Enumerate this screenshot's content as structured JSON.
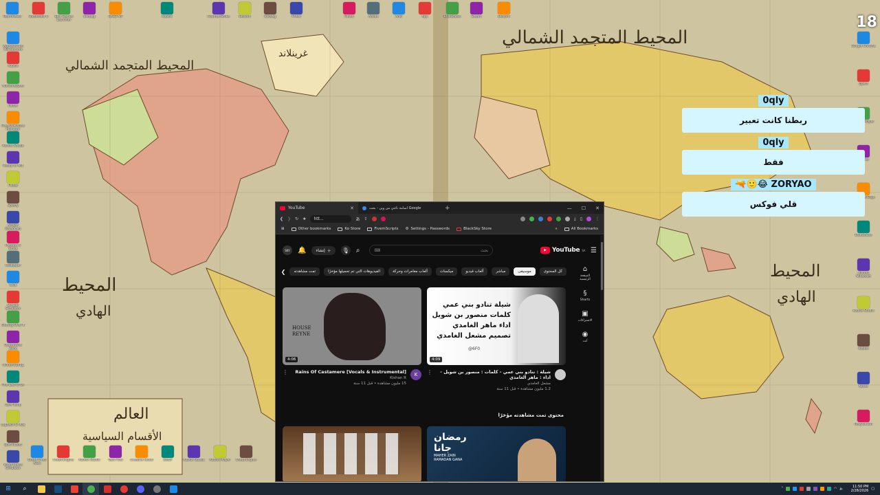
{
  "desktop": {
    "map_labels": {
      "north_pacific_left": "المحيط المتجمد الشمالي",
      "greenland": "غرينلاند",
      "north_pacific_right": "المحيط المتجمد الشمالي",
      "pacific_left": "المحيط",
      "pacific_left2": "الهادي",
      "pacific_right": "المحيط",
      "pacific_right2": "الهادي",
      "legend_title": "العالم",
      "legend_sub": "الأقسام السياسية"
    },
    "icons_top": [
      "TeamViewer",
      "Battlefield 4",
      "Epic Games Launcher",
      "ExitLag",
      "RAGE MP",
      "Roblox",
      "Counter-Strike",
      "Discord",
      "ExitLag",
      "FiveM",
      "Folder",
      "Adobe",
      "Anki",
      "App",
      "BlueStacks",
      "Steam",
      "Discord"
    ],
    "icons_left": [
      "Wondershare PDFelement",
      "Roblox",
      "Malwarebytes",
      "Folder",
      "Free Download Manager",
      "Roblox Studio",
      "Ready or Not",
      "Folder",
      "Spotify",
      "NVIDIA Broadcast",
      "Persona 5 Strike",
      "Wallpaper",
      "Wick",
      "Burglar Simulator",
      "Getting Over It",
      "Quarantine Zone",
      "HiddenConfig",
      "The Last of Us",
      "Core Temp",
      "Logitech G HUB",
      "Split Fiction",
      "Wrap House Simulator"
    ],
    "icons_right": [
      "Google Chrome",
      "Opera",
      "Roblox Player",
      "Games",
      "Microsoft Edge",
      "BlueStacks",
      "Hidden Minecraft",
      "Roblox Studio",
      "Roblox",
      "Notes",
      "Recycle Bin"
    ],
    "icons_bottom": [
      "Grand Theft Auto",
      "Cheat Engine",
      "Roblox Studio",
      "Task Flow",
      "Creative Cloud",
      "Zettlr",
      "Roblox Studio",
      "Roblox Player",
      "Cheat Engine"
    ],
    "corner_badge": "18"
  },
  "chat": [
    {
      "name": "0qly",
      "text": "ربطنا كانت تعبير"
    },
    {
      "name": "0qly",
      "text": "فقط"
    },
    {
      "name": "ZORYAO",
      "prefix": "🔫🙂😂",
      "text": "قلي فوكس"
    }
  ],
  "browser": {
    "tabs": [
      {
        "label": "YouTube",
        "active": true
      },
      {
        "label": "اسامة تاجي من وين - بحث Google",
        "active": false
      }
    ],
    "new_tab": "+",
    "window_controls": {
      "minimize": "—",
      "maximize": "☐",
      "close": "✕"
    },
    "url": "htt...",
    "bookmarks": [
      "Other bookmarks",
      "Ko Store",
      "FivemScripts",
      "Settings - Passwords",
      "BlackSky Store"
    ],
    "all_bookmarks": "All Bookmarks"
  },
  "youtube": {
    "logo": "YouTube",
    "logo_region": "SA",
    "search_placeholder": "بحث",
    "create_label": "إنشاء",
    "avatar_initials": "SKY",
    "chips": [
      "كل المحتوى",
      "موسيقى",
      "مباشر",
      "ألعاب فيديو",
      "ميكسات",
      "ألعاب مغامرات وحركة",
      "الفيديوهات التي تم تحميلها مؤخرًا",
      "تمت مشاهدته"
    ],
    "selected_chip": "موسيقى",
    "sidebar": [
      {
        "icon": "home-icon",
        "label": "الصفحة الرئيسية"
      },
      {
        "icon": "shorts-icon",
        "label": "Shorts"
      },
      {
        "icon": "subscriptions-icon",
        "label": "الاشتراكات"
      },
      {
        "icon": "you-icon",
        "label": "أنت"
      }
    ],
    "videos": [
      {
        "duration": "4:09",
        "thumb_lines": [
          "شيلة تنادو بني عمي",
          "كلمات منصور بن شويل",
          "اداء ماهر الغامدي",
          "تصميم مشعل الغامدي"
        ],
        "thumb_tag": "@6F0",
        "title": "شيلة : تنادو بني عمي - كلمات : منصور بن شويل - اداء : ماهر الغامدي",
        "channel": "مشعل الغامدي",
        "stats": "1.2 مليون مشاهدة • قبل 11 سنة",
        "avatar": ""
      },
      {
        "duration": "4:06",
        "thumb_lines": [
          "HOUSE",
          "REYNE"
        ],
        "thumb_tag": "",
        "title": "Rains Of Castamere [Vocals & Instrumental]",
        "channel": "Kishan R",
        "stats": "15 مليون مشاهدة • قبل 11 سنة",
        "avatar": "K"
      }
    ],
    "section_title": "محتوى تمت مشاهدته مؤخرًا",
    "bottom_videos": [
      {
        "thumb_lines": [
          "رمضان",
          "جانا",
          "MAHER ZAIN",
          "RAMADAN GANA"
        ]
      },
      {
        "thumb_lines": []
      }
    ]
  },
  "taskbar": {
    "clock_time": "11:50 PM",
    "clock_date": "2/28/2026"
  },
  "colors": {
    "youtube_red": "#ff0033",
    "chat_name_bg": "#a8e8ff",
    "chat_text_bg": "#d6f6ff",
    "taskbar_bg": "#1c2733",
    "map_land_yellow": "#e3c869",
    "map_land_pink": "#e0a48a",
    "map_sea": "#cfc4a0"
  }
}
